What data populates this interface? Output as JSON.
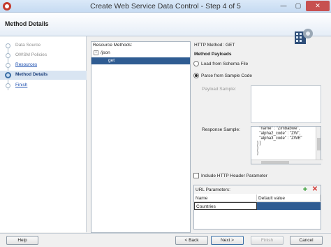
{
  "window": {
    "title": "Create Web Service Data Control - Step 4 of 5",
    "minimize": "—",
    "maximize": "▢",
    "close": "✕"
  },
  "header": {
    "title": "Method Details"
  },
  "nav": {
    "items": [
      {
        "label": "Data Source",
        "state": "done"
      },
      {
        "label": "OWSM Policies",
        "state": "done"
      },
      {
        "label": "Resources",
        "state": "link"
      },
      {
        "label": "Method Details",
        "state": "active"
      },
      {
        "label": "Finish",
        "state": "link"
      }
    ]
  },
  "resource_methods": {
    "label": "Resource Methods:",
    "tree": [
      {
        "label": "/json",
        "toggle": "−"
      },
      {
        "label": "get",
        "selected": true
      }
    ]
  },
  "method": {
    "http_method_label": "HTTP Method:",
    "http_method_value": "GET",
    "payloads_title": "Method Payloads",
    "load_schema_label": "Load from Schema File",
    "parse_sample_label": "Parse from Sample Code",
    "payload_sample_label": "Payload Sample:",
    "response_sample_label": "Response Sample:",
    "response_sample_text": "  \"name\" : \"Zimbabwe\",\n  \"alpha2_code\" : \"ZW\",\n  \"alpha3_code\" : \"ZWE\"\n} ]\n}\n}",
    "include_header_label": "Include HTTP Header Parameter"
  },
  "url_parameters": {
    "label": "URL Parameters:",
    "columns": [
      "Name",
      "Default value"
    ],
    "rows": [
      {
        "name": "Countries",
        "default": ""
      }
    ]
  },
  "buttons": {
    "help": "Help",
    "back": "< Back",
    "next": "Next >",
    "finish": "Finish",
    "cancel": "Cancel"
  },
  "colors": {
    "selection": "#2f5c92",
    "active_nav": "#d9e5f2",
    "link": "#1c4fb0"
  }
}
